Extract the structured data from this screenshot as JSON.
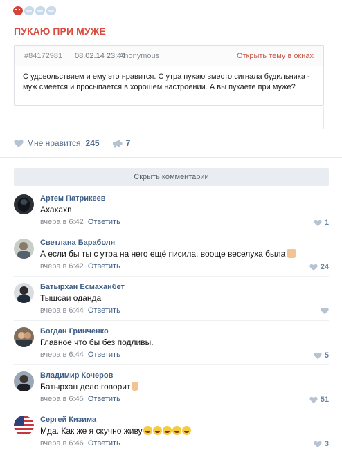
{
  "header_icons": [
    "devil-emoji-icon",
    "wind-emoji-icon",
    "wind-emoji-icon",
    "wind-emoji-icon"
  ],
  "post": {
    "title": "ПУКАЮ ПРИ МУЖЕ",
    "topic_id": "#84172981",
    "topic_date": "08.02.14 23:44",
    "topic_author": "Anonymous",
    "open_link": "Открыть тему в окнах",
    "body": "С удовольствием и ему это нравится. С утра пукаю вместо сигнала будильника - муж смеется и просыпается в хорошем настроении. А вы пукаете при муже?",
    "likes_label": "Мне нравится",
    "likes_count": "245",
    "reposts_count": "7"
  },
  "comments_toggle": "Скрыть комментарии",
  "comments": [
    {
      "author": "Артем Патрикеев",
      "text": "Ахахахв",
      "time": "вчера в 6:42",
      "reply": "Ответить",
      "likes": "1",
      "emoji": ""
    },
    {
      "author": "Светлана Бараболя",
      "text": "А если бы ты с утра на него ещё писила, вооще веселуха была",
      "time": "вчера в 6:42",
      "reply": "Ответить",
      "likes": "24",
      "emoji": "thumb"
    },
    {
      "author": "Батырхан Есмаханбет",
      "text": "Тышсаи оданда",
      "time": "вчера в 6:44",
      "reply": "Ответить",
      "likes": "",
      "emoji": ""
    },
    {
      "author": "Богдан Гринченко",
      "text": "Главное что бы без подливы.",
      "time": "вчера в 6:44",
      "reply": "Ответить",
      "likes": "5",
      "emoji": ""
    },
    {
      "author": "Владимир Кочеров",
      "text": "Батырхан дело говорит",
      "time": "вчера в 6:45",
      "reply": "Ответить",
      "likes": "51",
      "emoji": "point"
    },
    {
      "author": "Сергей Кизима",
      "text": "Мда. Как же я скучно живу",
      "time": "вчера в 6:46",
      "reply": "Ответить",
      "likes": "3",
      "emoji": "laugh5"
    }
  ],
  "colors": {
    "title": "#d84b3e",
    "link": "#3f5f86",
    "meta": "#8a8f96",
    "button_bg": "#e9ecf0"
  }
}
